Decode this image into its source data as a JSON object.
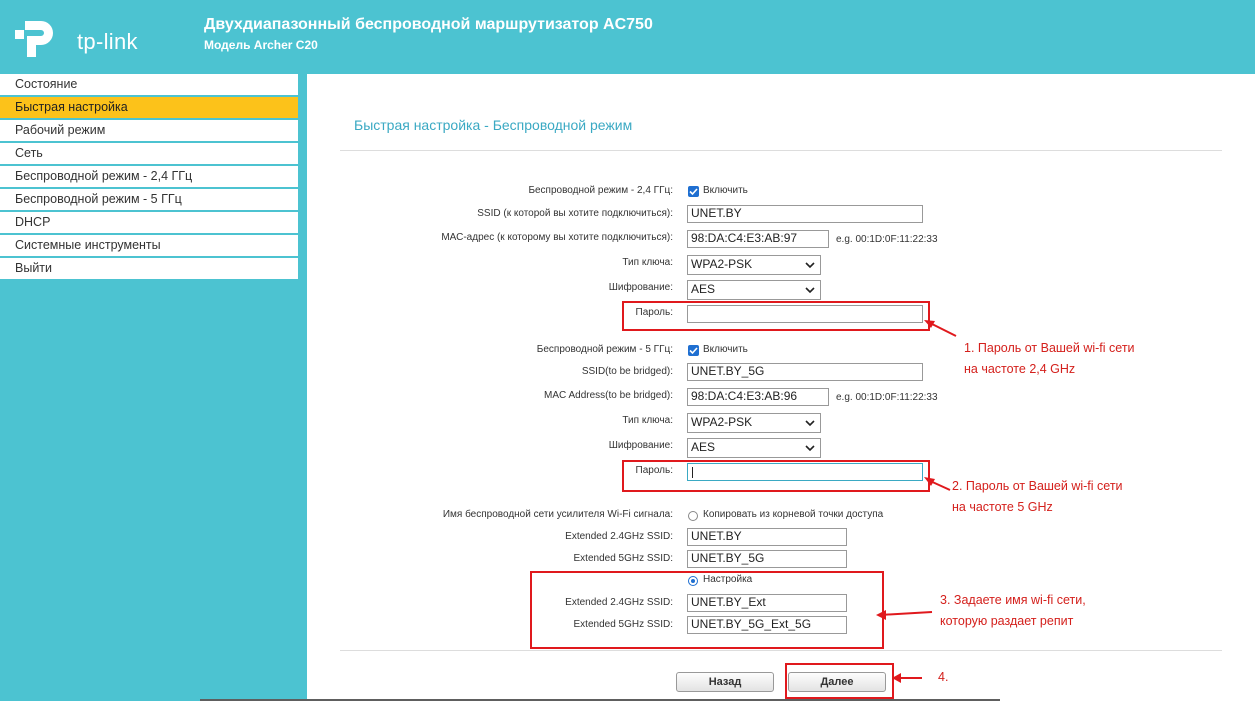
{
  "header": {
    "logo_text": "tp-link",
    "title": "Двухдиапазонный беспроводной маршрутизатор AC750",
    "model": "Модель Archer C20"
  },
  "sidebar": {
    "items": [
      {
        "label": "Состояние",
        "active": false
      },
      {
        "label": "Быстрая настройка",
        "active": true
      },
      {
        "label": "Рабочий режим",
        "active": false
      },
      {
        "label": "Сеть",
        "active": false
      },
      {
        "label": "Беспроводной режим - 2,4 ГГц",
        "active": false
      },
      {
        "label": "Беспроводной режим - 5 ГГц",
        "active": false
      },
      {
        "label": "DHCP",
        "active": false
      },
      {
        "label": "Системные инструменты",
        "active": false
      },
      {
        "label": "Выйти",
        "active": false
      }
    ]
  },
  "main": {
    "page_title": "Быстрая настройка - Беспроводной режим",
    "band24": {
      "mode_label": "Беспроводной режим - 2,4 ГГц:",
      "enable_label": "Включить",
      "ssid_label": "SSID (к которой вы хотите подключиться):",
      "ssid_value": "UNET.BY",
      "mac_label": "МАС-адрес (к которому вы хотите подключиться):",
      "mac_value": "98:DA:C4:E3:AB:97",
      "mac_example": "e.g. 00:1D:0F:11:22:33",
      "keytype_label": "Тип ключа:",
      "keytype_value": "WPA2-PSK",
      "encryption_label": "Шифрование:",
      "encryption_value": "AES",
      "password_label": "Пароль:",
      "password_value": ""
    },
    "band5": {
      "mode_label": "Беспроводной режим - 5 ГГц:",
      "enable_label": "Включить",
      "ssid_label": "SSID(to be bridged):",
      "ssid_value": "UNET.BY_5G",
      "mac_label": "MAC Address(to be bridged):",
      "mac_value": "98:DA:C4:E3:AB:96",
      "mac_example": "e.g. 00:1D:0F:11:22:33",
      "keytype_label": "Тип ключа:",
      "keytype_value": "WPA2-PSK",
      "encryption_label": "Шифрование:",
      "encryption_value": "AES",
      "password_label": "Пароль:",
      "password_value": ""
    },
    "extender": {
      "name_label": "Имя беспроводной сети усилителя Wi-Fi сигнала:",
      "copy_option": "Копировать из корневой точки доступа",
      "ext24_label": "Extended 2.4GHz SSID:",
      "ext24_copy_value": "UNET.BY",
      "ext5_label": "Extended 5GHz SSID:",
      "ext5_copy_value": "UNET.BY_5G",
      "custom_option": "Настройка",
      "ext24_custom_value": "UNET.BY_Ext",
      "ext5_custom_value": "UNET.BY_5G_Ext_5G"
    },
    "buttons": {
      "back": "Назад",
      "next": "Далее"
    }
  },
  "annotations": {
    "note1_line1": "1. Пароль от Вашей wi-fi сети",
    "note1_line2": "на частоте 2,4 GHz",
    "note2_line1": "2. Пароль от Вашей wi-fi сети",
    "note2_line2": "на частоте 5 GHz",
    "note3_line1": "3. Задаете имя wi-fi сети,",
    "note3_line2": "которую раздает репит",
    "note4": "4.",
    "color": "#e0191d"
  },
  "colors": {
    "brand": "#4cc3d1",
    "active_nav": "#fcc21a",
    "title_text": "#3aa9c3"
  }
}
